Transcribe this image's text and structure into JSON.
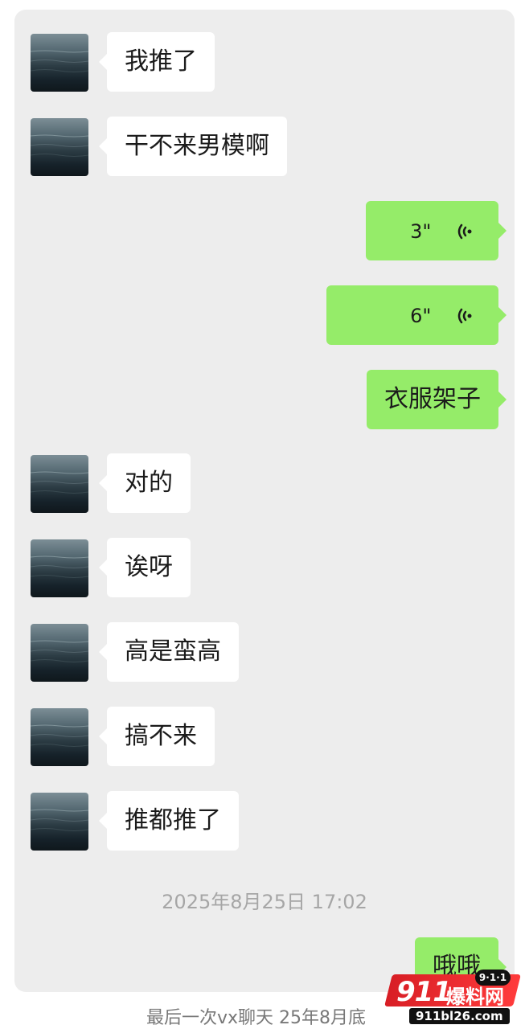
{
  "messages": [
    {
      "side": "left",
      "text": "我推了"
    },
    {
      "side": "left",
      "text": "干不来男模啊"
    },
    {
      "side": "right",
      "type": "voice",
      "duration": "3\""
    },
    {
      "side": "right",
      "type": "voice",
      "duration": "6\""
    },
    {
      "side": "right",
      "text": "衣服架子"
    },
    {
      "side": "left",
      "text": "对的"
    },
    {
      "side": "left",
      "text": "诶呀"
    },
    {
      "side": "left",
      "text": "高是蛮高"
    },
    {
      "side": "left",
      "text": "搞不来"
    },
    {
      "side": "left",
      "text": "推都推了"
    },
    {
      "side": "right",
      "text": "哦哦"
    }
  ],
  "timestamp": "2025年8月25日 17:02",
  "footer_caption": "最后一次vx聊天 25年8月底",
  "watermark": {
    "number": "911",
    "text": "爆料网",
    "badge": "9·1·1",
    "url": "911bl26.com"
  },
  "colors": {
    "chat_background": "#ededed",
    "incoming_bubble": "#ffffff",
    "outgoing_bubble": "#95ec69",
    "timestamp_text": "#a6a6a6",
    "watermark_red": "#d81e25"
  },
  "icons": {
    "voice": "voice-wave-icon",
    "avatar": "sea-avatar"
  }
}
